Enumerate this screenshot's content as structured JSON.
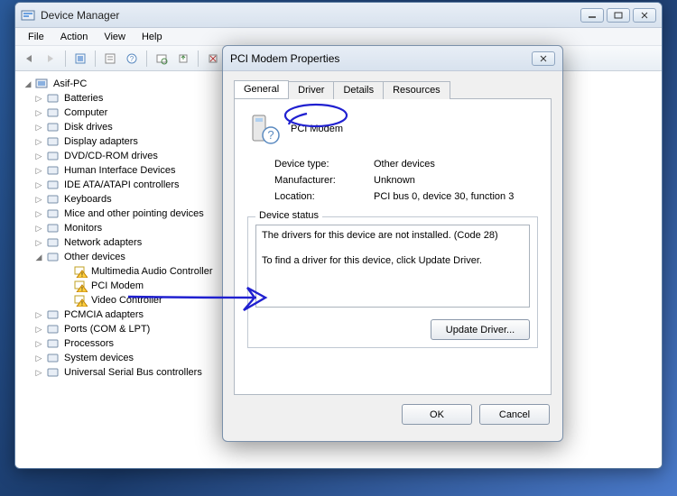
{
  "window": {
    "title": "Device Manager",
    "menus": [
      "File",
      "Action",
      "View",
      "Help"
    ]
  },
  "tree": {
    "root": "Asif-PC",
    "nodes": [
      {
        "label": "Batteries",
        "icon": "battery"
      },
      {
        "label": "Computer",
        "icon": "computer"
      },
      {
        "label": "Disk drives",
        "icon": "disk"
      },
      {
        "label": "Display adapters",
        "icon": "display"
      },
      {
        "label": "DVD/CD-ROM drives",
        "icon": "dvd"
      },
      {
        "label": "Human Interface Devices",
        "icon": "hid"
      },
      {
        "label": "IDE ATA/ATAPI controllers",
        "icon": "ide"
      },
      {
        "label": "Keyboards",
        "icon": "keyboard"
      },
      {
        "label": "Mice and other pointing devices",
        "icon": "mouse"
      },
      {
        "label": "Monitors",
        "icon": "monitor"
      },
      {
        "label": "Network adapters",
        "icon": "network"
      },
      {
        "label": "Other devices",
        "icon": "other",
        "expanded": true,
        "children": [
          {
            "label": "Multimedia Audio Controller",
            "warn": true
          },
          {
            "label": "PCI Modem",
            "warn": true
          },
          {
            "label": "Video Controller",
            "warn": true
          }
        ]
      },
      {
        "label": "PCMCIA adapters",
        "icon": "pcmcia"
      },
      {
        "label": "Ports (COM & LPT)",
        "icon": "ports"
      },
      {
        "label": "Processors",
        "icon": "cpu"
      },
      {
        "label": "System devices",
        "icon": "system"
      },
      {
        "label": "Universal Serial Bus controllers",
        "icon": "usb"
      }
    ]
  },
  "dialog": {
    "title": "PCI Modem Properties",
    "tabs": [
      "General",
      "Driver",
      "Details",
      "Resources"
    ],
    "active_tab": "General",
    "device_name": "PCI Modem",
    "props": {
      "type_label": "Device type:",
      "type_value": "Other devices",
      "mfr_label": "Manufacturer:",
      "mfr_value": "Unknown",
      "loc_label": "Location:",
      "loc_value": "PCI bus 0, device 30, function 3"
    },
    "status": {
      "group_label": "Device status",
      "text": "The drivers for this device are not installed. (Code 28)\n\nTo find a driver for this device, click Update Driver."
    },
    "buttons": {
      "update": "Update Driver...",
      "ok": "OK",
      "cancel": "Cancel"
    }
  }
}
